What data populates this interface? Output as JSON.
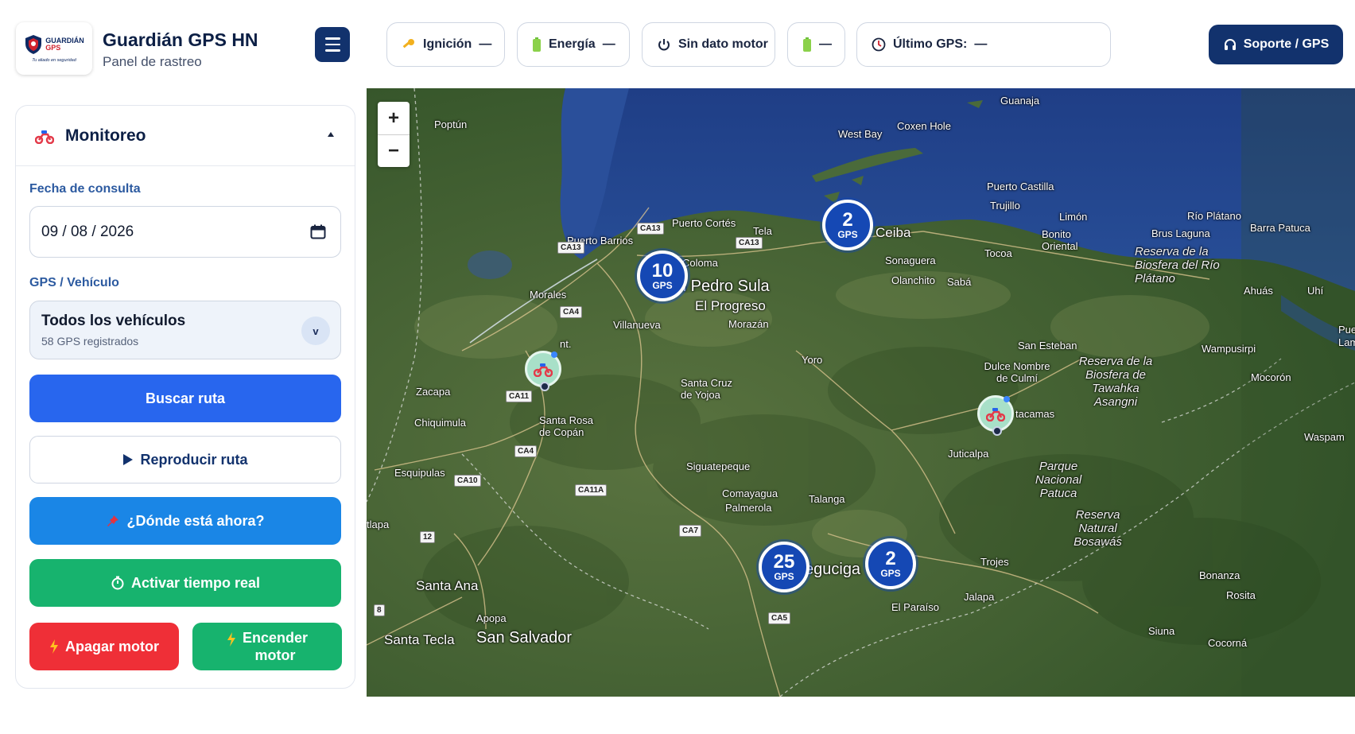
{
  "header": {
    "logo": {
      "word_top": "GUARDIÁN",
      "word_bottom": "GPS",
      "tagline": "Tu aliado en seguridad"
    },
    "title": "Guardián GPS HN",
    "subtitle": "Panel de rastreo",
    "status_pills": [
      {
        "label": "Ignición",
        "value": "—",
        "icon": "key-icon"
      },
      {
        "label": "Energía",
        "value": "—",
        "icon": "battery-icon"
      },
      {
        "label": "Sin dato motor",
        "icon": "power-icon"
      },
      {
        "value": "—",
        "icon": "battery-icon"
      },
      {
        "label": "Último GPS:",
        "value": "—",
        "icon": "clock-icon"
      }
    ],
    "support_label": "Soporte / GPS"
  },
  "sidebar": {
    "section_title": "Monitoreo",
    "date_label": "Fecha de consulta",
    "date_value": "09 / 08 / 2026",
    "vehicle_label": "GPS / Vehículo",
    "vehicle_selected": "Todos los vehículos",
    "vehicle_count": "58 GPS registrados",
    "buttons": {
      "search_route": "Buscar ruta",
      "replay_route": "Reproducir ruta",
      "where_now": "¿Dónde está ahora?",
      "realtime": "Activar tiempo real",
      "engine_off": "Apagar motor",
      "engine_on_line1": "Encender",
      "engine_on_line2": "motor"
    }
  },
  "map": {
    "zoom_in": "+",
    "zoom_out": "−",
    "clusters": [
      {
        "count": "2",
        "unit": "GPS"
      },
      {
        "count": "10",
        "unit": "GPS"
      },
      {
        "count": "25",
        "unit": "GPS"
      },
      {
        "count": "2",
        "unit": "GPS"
      }
    ],
    "places": [
      "Poptún",
      "Guanaja",
      "West Bay",
      "Coxen Hole",
      "Puerto Castilla",
      "Trujillo",
      "Limón",
      "Río Plátano",
      "Barra Patuca",
      "Brus Laguna",
      "Bonito Oriental",
      "Tocoa",
      "Puerto Cortés",
      "Tela",
      "Ceiba",
      "Sonaguera",
      "Olanchito",
      "Sabá",
      "Puerto Barrios",
      "Coloma",
      "n Pedro Sula",
      "El Progreso",
      "Morazán",
      "Morales",
      "Villanueva",
      "Yoro",
      "Ahuás",
      "Uhí",
      "Puer",
      "Lam",
      "San Esteban",
      "Dulce Nombre de Culmí",
      "Wampusirpi",
      "Mocorón",
      "Zacapa",
      "Santa Cruz de Yojoa",
      "Chiquimula",
      "Santa Rosa de Copán",
      "tacamas",
      "Juticalpa",
      "Waspam",
      "Siguatepeque",
      "Esquipulas",
      "Comayagua",
      "Palmerola",
      "Talanga",
      "tlapa",
      "Santa Ana",
      "eguciga",
      "Trojes",
      "Jalapa",
      "El Paraíso",
      "Bonanza",
      "Rosita",
      "Apopa",
      "Santa Tecla",
      "San Salvador",
      "Siuna",
      "Cocorná",
      "nt."
    ],
    "reserves": [
      "Reserva de la Biosfera del Río Plátano",
      "Reserva de la Biosfera de Tawahka Asangni",
      "Parque Nacional Patuca",
      "Reserva Natural Bosawás"
    ],
    "road_badges": [
      "CA13",
      "CA13",
      "CA13",
      "CA4",
      "CA11",
      "CA4",
      "CA10",
      "CA11A",
      "CA7",
      "12",
      "8",
      "CA5"
    ]
  }
}
